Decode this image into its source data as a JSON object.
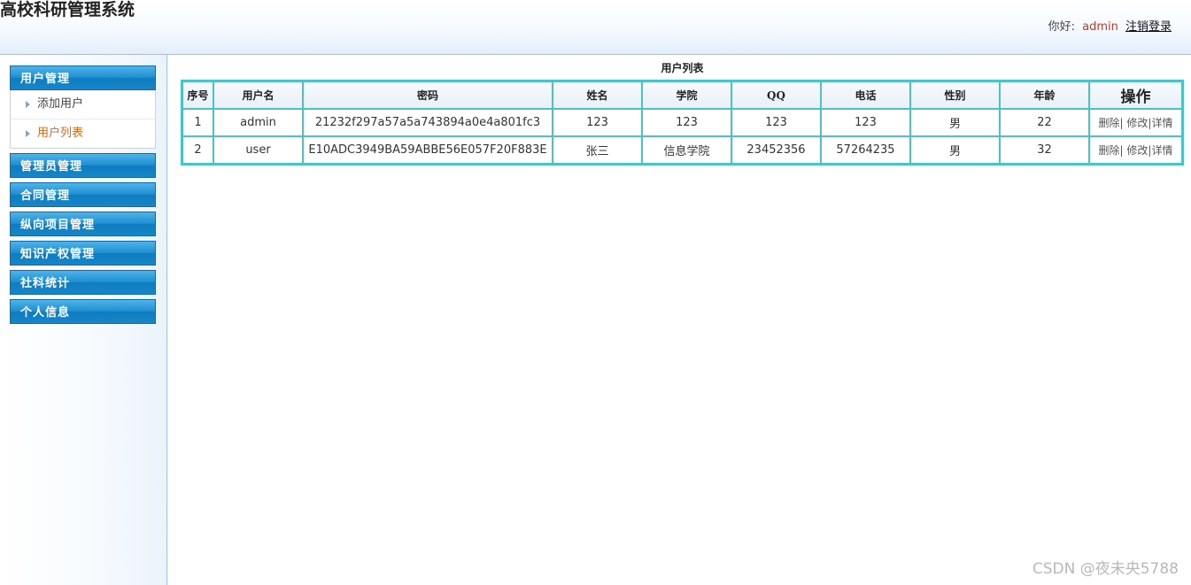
{
  "header": {
    "title": "高校科研管理系统",
    "greeting": "你好:",
    "username": "admin",
    "logout": "注销登录"
  },
  "sidebar": {
    "groups": [
      {
        "label": "用户管理",
        "items": [
          {
            "label": "添加用户"
          },
          {
            "label": "用户列表",
            "active": true
          }
        ]
      },
      {
        "label": "管理员管理"
      },
      {
        "label": "合同管理"
      },
      {
        "label": "纵向项目管理"
      },
      {
        "label": "知识产权管理"
      },
      {
        "label": "社科统计"
      },
      {
        "label": "个人信息"
      }
    ]
  },
  "main": {
    "caption": "用户列表",
    "columns": [
      "序号",
      "用户名",
      "密码",
      "姓名",
      "学院",
      "QQ",
      "电话",
      "性别",
      "年龄",
      "操作"
    ],
    "rows": [
      {
        "no": "1",
        "username": "admin",
        "password": "21232f297a57a5a743894a0e4a801fc3",
        "name": "123",
        "college": "123",
        "qq": "123",
        "phone": "123",
        "gender": "男",
        "age": "22"
      },
      {
        "no": "2",
        "username": "user",
        "password": "E10ADC3949BA59ABBE56E057F20F883E",
        "name": "张三",
        "college": "信息学院",
        "qq": "23452356",
        "phone": "57264235",
        "gender": "男",
        "age": "32"
      }
    ],
    "actions": {
      "delete": "删除",
      "edit": "修改",
      "detail": "详情",
      "separator": "|"
    }
  },
  "watermark": "CSDN @夜未央5788"
}
